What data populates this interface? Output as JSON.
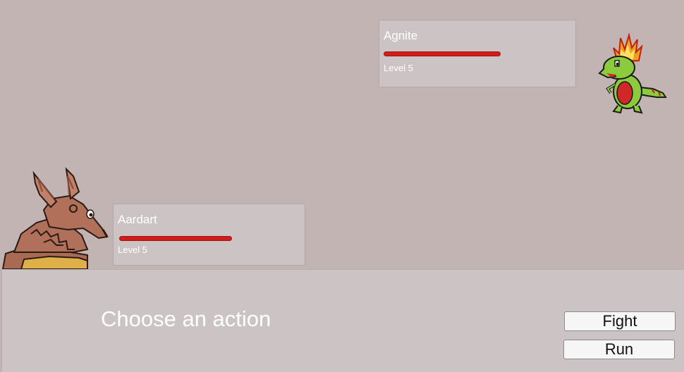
{
  "enemy": {
    "name": "Agnite",
    "level_text": "Level 5",
    "hp_fraction": 1.0,
    "sprite_icon": "fire-lizard-creature-sprite"
  },
  "player": {
    "name": "Aardart",
    "level_text": "Level 5",
    "hp_fraction": 1.0,
    "sprite_icon": "aardvark-creature-sprite"
  },
  "dialog": {
    "prompt": "Choose an action"
  },
  "actions": {
    "fight_label": "Fight",
    "run_label": "Run"
  },
  "colors": {
    "background": "#c3b4b4",
    "panel": "#ccc4c4",
    "hp_bar": "#d21b1b",
    "text": "#ffffff"
  }
}
